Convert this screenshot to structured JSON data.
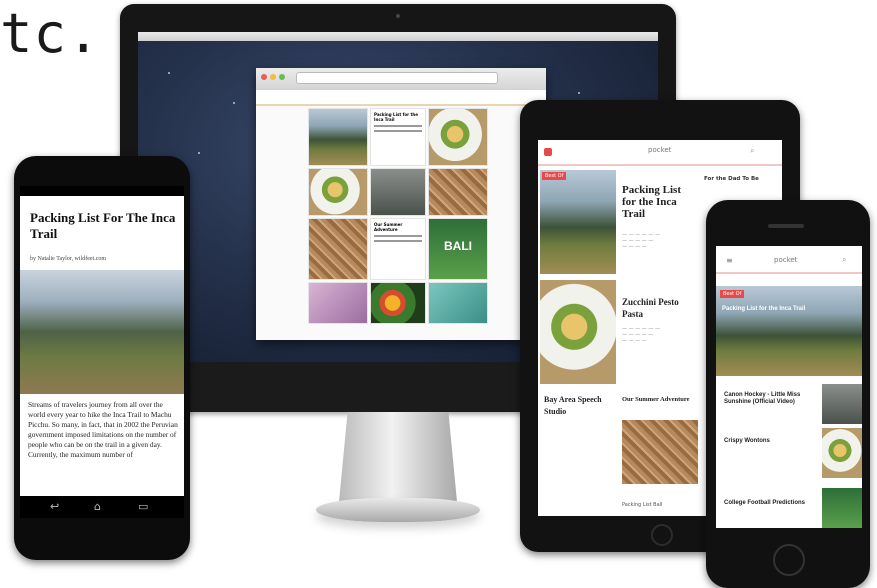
{
  "heading": "tc.",
  "imac": {
    "browser_tiles": [
      {
        "kind": "image",
        "style": "mountain"
      },
      {
        "kind": "text",
        "title": "Packing List for the Inca Trail"
      },
      {
        "kind": "image",
        "style": "food"
      },
      {
        "kind": "image",
        "style": "food"
      },
      {
        "kind": "image",
        "style": "road"
      },
      {
        "kind": "image",
        "style": "wood"
      },
      {
        "kind": "image",
        "style": "wood"
      },
      {
        "kind": "text",
        "title": "Our Summer Adventure"
      },
      {
        "kind": "image",
        "style": "bali"
      },
      {
        "kind": "image",
        "style": "purple"
      },
      {
        "kind": "image",
        "style": "fruit"
      },
      {
        "kind": "image",
        "style": "gift"
      }
    ],
    "bali_text": "BALI"
  },
  "tablet": {
    "app_name": "pocket",
    "tag_label": "Best Of",
    "col2_title_1": "Packing List for the Inca Trail",
    "col2_title_2": "Zucchini Pesto Pasta",
    "col3_title_1": "For the Dad To Be",
    "col1_title_bottom": "Bay Area Speech Studio",
    "col2_title_bottom": "Our Summer Adventure",
    "footer_item": "Packing List Ball"
  },
  "android": {
    "article_title": "Packing List For The Inca Trail",
    "byline": "by Natalie Taylor, wildfeet.com",
    "body": "Streams of travelers journey from all over the world every year to hike the Inca Trail to Machu Picchu. So many, in fact, that in 2002 the Peruvian government imposed limitations on the number of people who can be on the trail in a given day. Currently, the maximum number of"
  },
  "iphone": {
    "app_name": "pocket",
    "tag_label": "Best Of",
    "featured_title": "Packing List for the Inca Trail",
    "items": [
      "Canon Hockey - Little Miss Sunshine (Official Video)",
      "Crispy Wontons",
      "College Football Predictions"
    ]
  }
}
